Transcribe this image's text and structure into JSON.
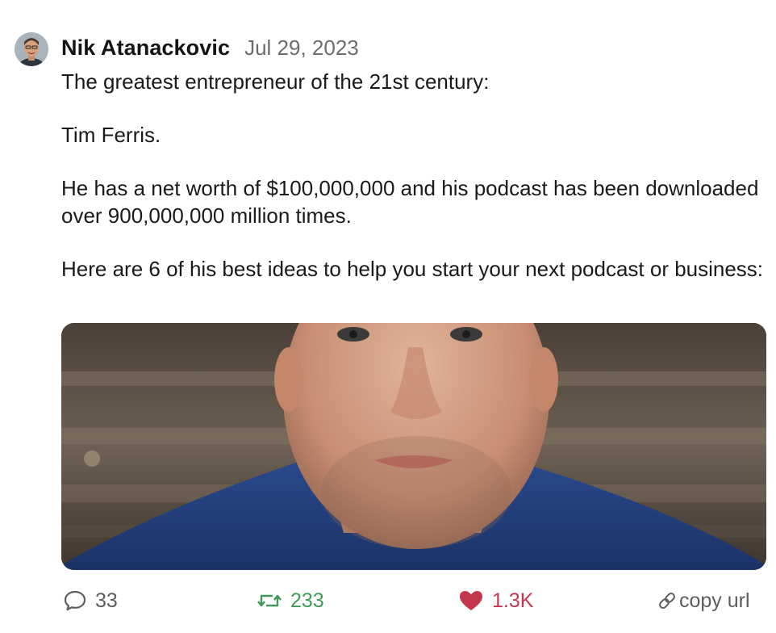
{
  "post": {
    "author": "Nik Atanackovic",
    "date": "Jul 29, 2023",
    "paragraphs": [
      "The greatest entrepreneur of the 21st century:",
      "Tim Ferris.",
      "He has a net worth of $100,000,000 and his podcast has been downloaded over 900,000,000 million times.",
      "Here are 6 of his best ideas to help you start your next podcast or business:"
    ]
  },
  "actions": {
    "replies": "33",
    "reposts": "233",
    "likes": "1.3K",
    "copy_url": "copy url"
  },
  "icons": {
    "reply": "speech-bubble-icon",
    "repost": "repost-arrows-icon",
    "like": "heart-icon",
    "copy": "link-icon"
  },
  "colors": {
    "author": "#141414",
    "date": "#6c6c6c",
    "repost": "#3f9a5a",
    "like": "#c4364e",
    "muted": "#5d5d5d"
  }
}
